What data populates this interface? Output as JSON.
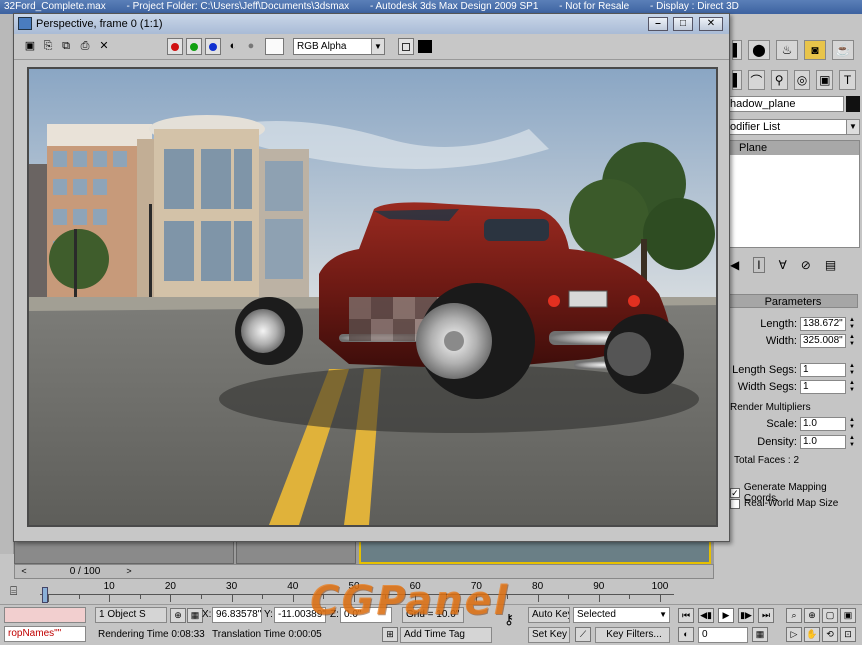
{
  "app": {
    "title_parts": [
      "32Ford_Complete.max",
      "- Project Folder: C:\\Users\\Jeff\\Documents\\3dsmax",
      "- Autodesk 3ds Max Design 2009 SP1",
      "- Not for Resale",
      "- Display : Direct 3D"
    ]
  },
  "render_window": {
    "title": "Perspective, frame 0 (1:1)",
    "channel": "RGB Alpha",
    "buttons": {
      "minimize": "⎯",
      "maximize": "□",
      "close": "✕"
    }
  },
  "command_panel": {
    "object_name": "hadow_plane",
    "modifier_list": "odifier List",
    "stack_item": "Plane",
    "parameters": {
      "header": "Parameters",
      "length_label": "Length:",
      "length_value": "138.672\"",
      "width_label": "Width:",
      "width_value": "325.008\"",
      "length_segs_label": "Length Segs:",
      "length_segs_value": "1",
      "width_segs_label": "Width Segs:",
      "width_segs_value": "1",
      "render_multipliers": "Render Multipliers",
      "scale_label": "Scale:",
      "scale_value": "1.0",
      "density_label": "Density:",
      "density_value": "1.0",
      "total_faces": "Total Faces : 2",
      "gen_mapping": "Generate Mapping Coords.",
      "real_world": "Real-World Map Size"
    }
  },
  "time_slider": {
    "frame": "0 / 100",
    "prev": "<",
    "next": ">"
  },
  "track_bar": {
    "labels": [
      "10",
      "20",
      "30",
      "40",
      "50",
      "60",
      "70",
      "80",
      "90",
      "100"
    ]
  },
  "status": {
    "script_listener": "ropNames\"\"",
    "selection": "1 Object S",
    "x_label": "X:",
    "x_value": "96.83578\"",
    "y_label": "Y:",
    "y_value": "-11.00389\"",
    "z_label": "Z:",
    "z_value": "0.0\"",
    "grid": "Grid = 10.0\"",
    "rendering_time": "Rendering Time  0:08:33",
    "translation_time": "Translation Time  0:00:05",
    "add_time_tag": "Add Time Tag",
    "auto_key": "Auto Key",
    "set_key": "Set Key",
    "selected": "Selected",
    "key_filters": "Key Filters...",
    "frame_field": "0"
  },
  "watermark": {
    "text": "CGPanel"
  },
  "colors": {
    "accent": "#e8c44a",
    "title_bar": "#3d62a0",
    "red": "#d01010",
    "green": "#10a010",
    "blue": "#1030d0"
  }
}
